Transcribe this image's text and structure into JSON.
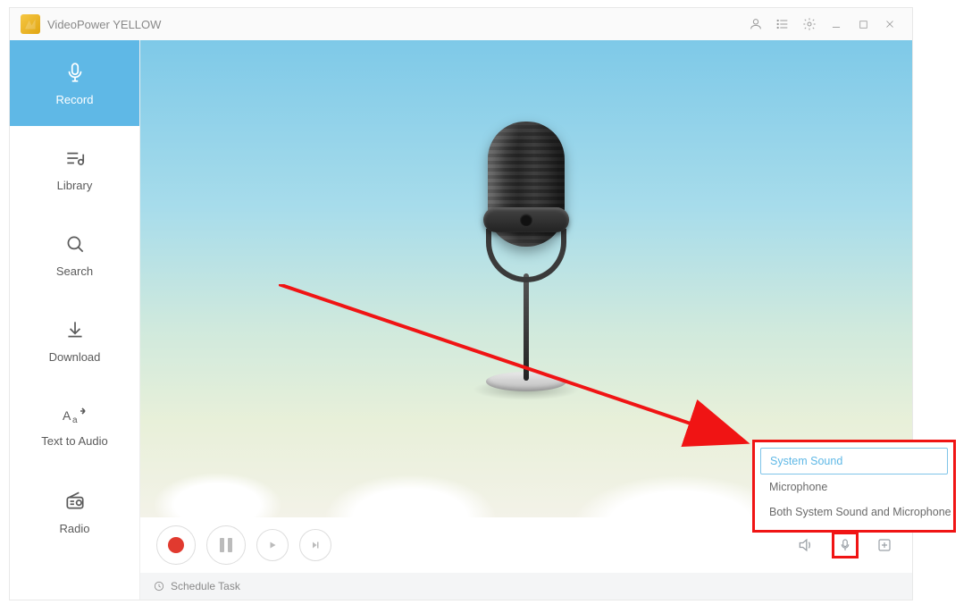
{
  "titlebar": {
    "app_name": "VideoPower YELLOW"
  },
  "sidebar": {
    "items": [
      {
        "label": "Record"
      },
      {
        "label": "Library"
      },
      {
        "label": "Search"
      },
      {
        "label": "Download"
      },
      {
        "label": "Text to Audio"
      },
      {
        "label": "Radio"
      }
    ]
  },
  "footer": {
    "schedule_label": "Schedule Task"
  },
  "popup": {
    "options": [
      "System Sound",
      "Microphone",
      "Both System Sound and Microphone"
    ]
  }
}
